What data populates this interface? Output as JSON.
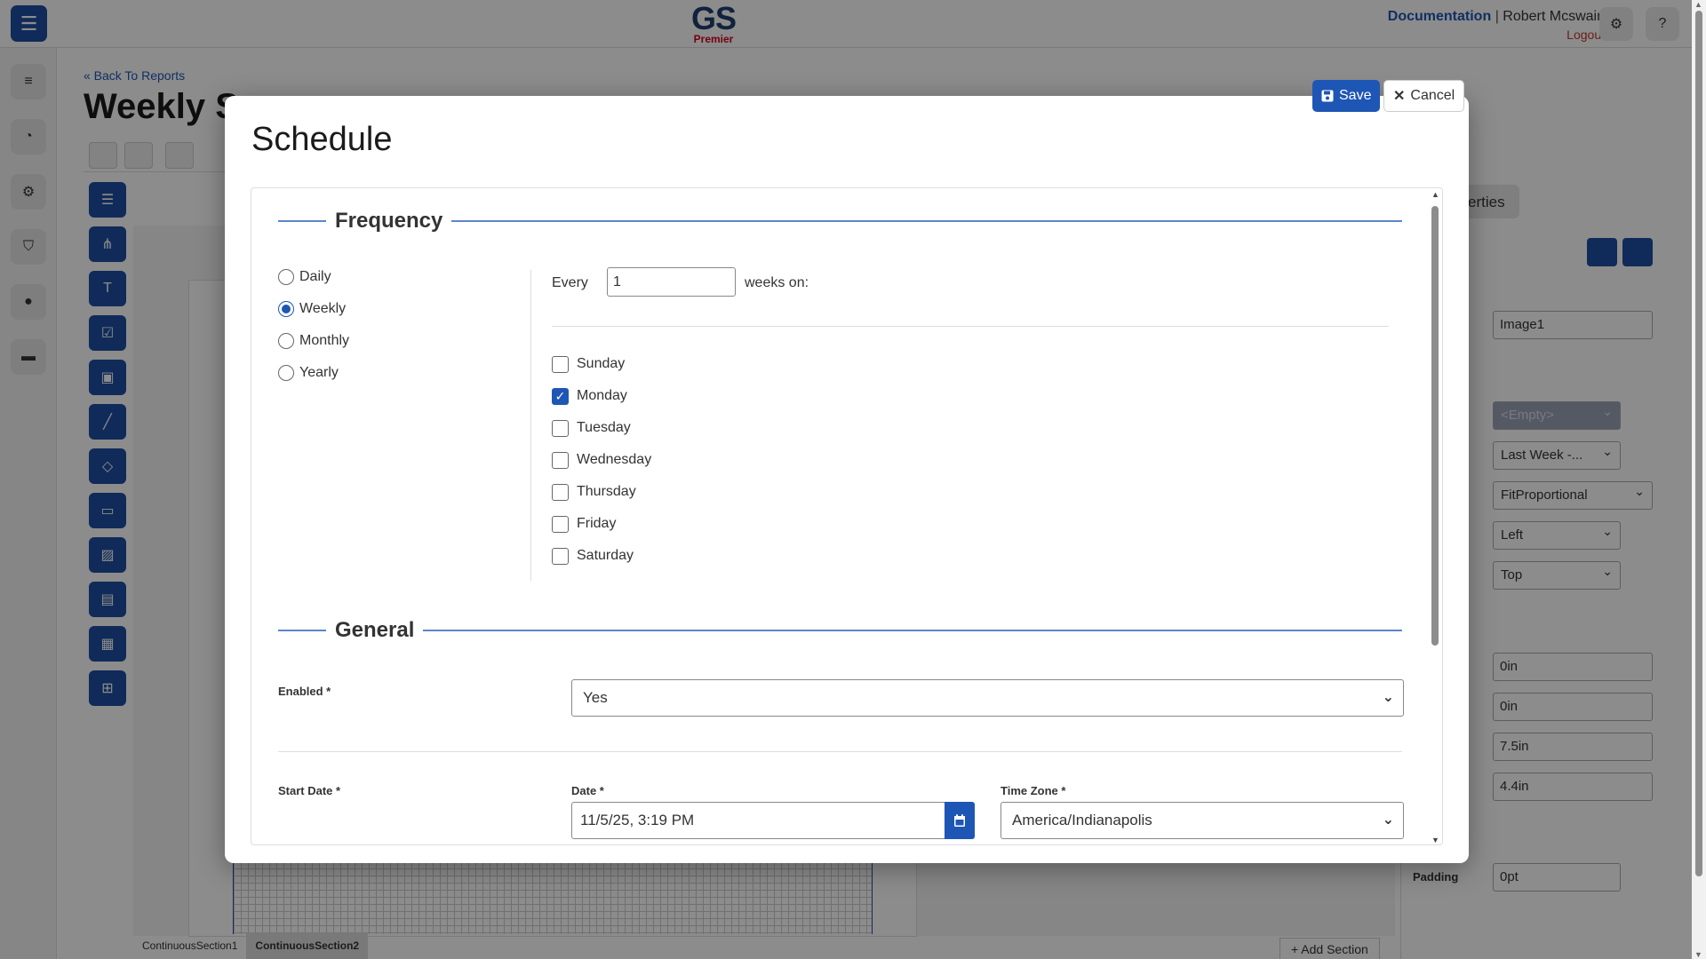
{
  "header": {
    "logo_text": "GS",
    "logo_sub": "Premier",
    "documentation": "Documentation",
    "separator": "|",
    "user_name": "Robert Mcswain",
    "logout": "Logout"
  },
  "page": {
    "back_link": "« Back To Reports",
    "title": "Weekly S"
  },
  "designer": {
    "properties_tab": "erties",
    "section_tabs": [
      "ContinuousSection1",
      "ContinuousSection2"
    ],
    "add_section": "+ Add Section",
    "props": {
      "name_value": "Image1",
      "empty_select": "<Empty>",
      "last_week_select": "Last Week -...",
      "sizing_select": "FitProportional",
      "halign_select": "Left",
      "valign_select": "Top",
      "left": "0in",
      "top": "0in",
      "width": "7.5in",
      "height": "4.4in",
      "padding_label": "Padding",
      "padding_value": "0pt"
    }
  },
  "modal": {
    "title": "Schedule",
    "save_label": "Save",
    "cancel_label": "Cancel",
    "frequency": {
      "heading": "Frequency",
      "options": [
        {
          "label": "Daily",
          "checked": false
        },
        {
          "label": "Weekly",
          "checked": true
        },
        {
          "label": "Monthly",
          "checked": false
        },
        {
          "label": "Yearly",
          "checked": false
        }
      ],
      "every_label": "Every",
      "every_value": "1",
      "weeks_on_label": "weeks on:",
      "days": [
        {
          "label": "Sunday",
          "checked": false
        },
        {
          "label": "Monday",
          "checked": true
        },
        {
          "label": "Tuesday",
          "checked": false
        },
        {
          "label": "Wednesday",
          "checked": false
        },
        {
          "label": "Thursday",
          "checked": false
        },
        {
          "label": "Friday",
          "checked": false
        },
        {
          "label": "Saturday",
          "checked": false
        }
      ]
    },
    "general": {
      "heading": "General",
      "enabled_label": "Enabled *",
      "enabled_value": "Yes",
      "start_date_label": "Start Date *",
      "date_label": "Date *",
      "date_value": "11/5/25, 3:19 PM",
      "timezone_label": "Time Zone *",
      "timezone_value": "America/Indianapolis"
    }
  },
  "colors": {
    "accent": "#1e56b5",
    "danger": "#c0392b"
  }
}
